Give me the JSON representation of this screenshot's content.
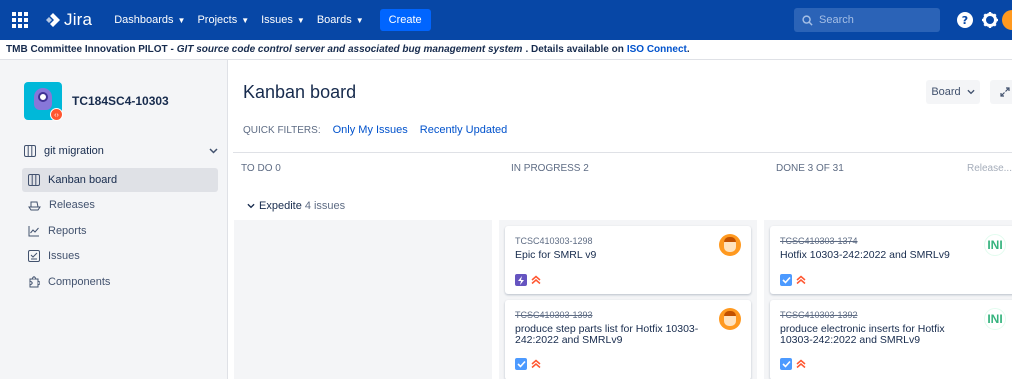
{
  "topnav": {
    "logo": "Jira",
    "items": [
      {
        "label": "Dashboards"
      },
      {
        "label": "Projects"
      },
      {
        "label": "Issues"
      },
      {
        "label": "Boards"
      }
    ],
    "create_label": "Create",
    "search_placeholder": "Search"
  },
  "banner": {
    "prefix": "TMB Committee Innovation PILOT - ",
    "italic": "GIT source code control server and associated bug management system",
    "suffix": ". Details available on",
    "link": "ISO Connect",
    "end": "."
  },
  "sidebar": {
    "project_name": "TC184SC4-10303",
    "board_name": "git migration",
    "items": [
      {
        "label": "Kanban board",
        "icon": "board-icon",
        "active": true
      },
      {
        "label": "Releases",
        "icon": "ship-icon"
      },
      {
        "label": "Reports",
        "icon": "chart-icon"
      },
      {
        "label": "Issues",
        "icon": "issues-icon"
      },
      {
        "label": "Components",
        "icon": "puzzle-icon"
      }
    ]
  },
  "main": {
    "title": "Kanban board",
    "board_button": "Board",
    "quick_filters_label": "QUICK FILTERS:",
    "quick_filters": [
      "Only My Issues",
      "Recently Updated"
    ],
    "columns": [
      {
        "title": "TO DO 0"
      },
      {
        "title": "IN PROGRESS 2"
      },
      {
        "title": "DONE 3 OF 31",
        "release": "Release..."
      }
    ],
    "swimlane": {
      "name": "Expedite",
      "count": "4 issues"
    },
    "cards": {
      "prog1": {
        "key": "TCSC410303-1298",
        "summary": "Epic for SMRL v9",
        "type": "epic-icon"
      },
      "prog2": {
        "key": "TCSC410303-1393",
        "summary": "produce step parts list for Hotfix 10303-242:2022 and SMRLv9",
        "type": "task-icon"
      },
      "done1": {
        "key": "TCSC410303-1374",
        "summary": "Hotfix 10303-242:2022 and SMRLv9",
        "type": "task-icon"
      },
      "done2": {
        "key": "TCSC410303-1392",
        "summary": "produce electronic inserts for Hotfix 10303-242:2022 and SMRLv9",
        "type": "task-icon"
      }
    }
  },
  "colors": {
    "nav": "#0747a6",
    "create": "#0065ff",
    "link": "#0052cc",
    "epic": "#6554c0",
    "task": "#4c9aff",
    "priority": "#ff5630"
  }
}
